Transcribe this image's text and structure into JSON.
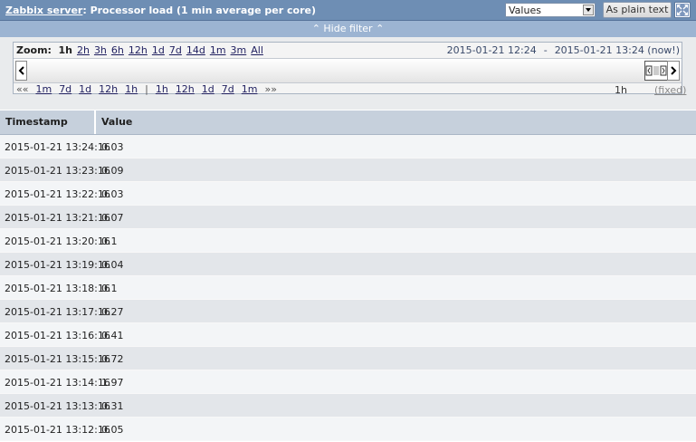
{
  "header": {
    "host_link": "Zabbix server",
    "title_rest": ": Processor load (1 min average per core)",
    "view_select": "Values",
    "plain_text_button": "As plain text"
  },
  "filter_toggle": "Hide filter",
  "zoom": {
    "label": "Zoom:",
    "options": [
      "1h",
      "2h",
      "3h",
      "6h",
      "12h",
      "1d",
      "7d",
      "14d",
      "1m",
      "3m",
      "All"
    ],
    "from": "2015-01-21 12:24",
    "separator": "-",
    "to": "2015-01-21 13:24 (now!)"
  },
  "nav": {
    "back_all": "««",
    "back": [
      "1m",
      "7d",
      "1d",
      "12h",
      "1h"
    ],
    "divider": "|",
    "forward": [
      "1h",
      "12h",
      "1d",
      "7d",
      "1m"
    ],
    "forward_all": "»»",
    "period": "1h",
    "fixed": "(fixed)"
  },
  "table": {
    "columns": [
      "Timestamp",
      "Value"
    ],
    "rows": [
      [
        "2015-01-21 13:24:16",
        "0.03"
      ],
      [
        "2015-01-21 13:23:16",
        "0.09"
      ],
      [
        "2015-01-21 13:22:16",
        "0.03"
      ],
      [
        "2015-01-21 13:21:16",
        "0.07"
      ],
      [
        "2015-01-21 13:20:16",
        "0.1"
      ],
      [
        "2015-01-21 13:19:16",
        "0.04"
      ],
      [
        "2015-01-21 13:18:16",
        "0.1"
      ],
      [
        "2015-01-21 13:17:16",
        "0.27"
      ],
      [
        "2015-01-21 13:16:16",
        "0.41"
      ],
      [
        "2015-01-21 13:15:16",
        "0.72"
      ],
      [
        "2015-01-21 13:14:16",
        "1.97"
      ],
      [
        "2015-01-21 13:13:16",
        "0.31"
      ],
      [
        "2015-01-21 13:12:16",
        "0.05"
      ]
    ]
  },
  "colors": {
    "header_bg": "#6e8eb4",
    "filterbar_bg": "#9cb4d2",
    "row_odd": "#f3f5f7",
    "row_even": "#e3e6ea"
  }
}
